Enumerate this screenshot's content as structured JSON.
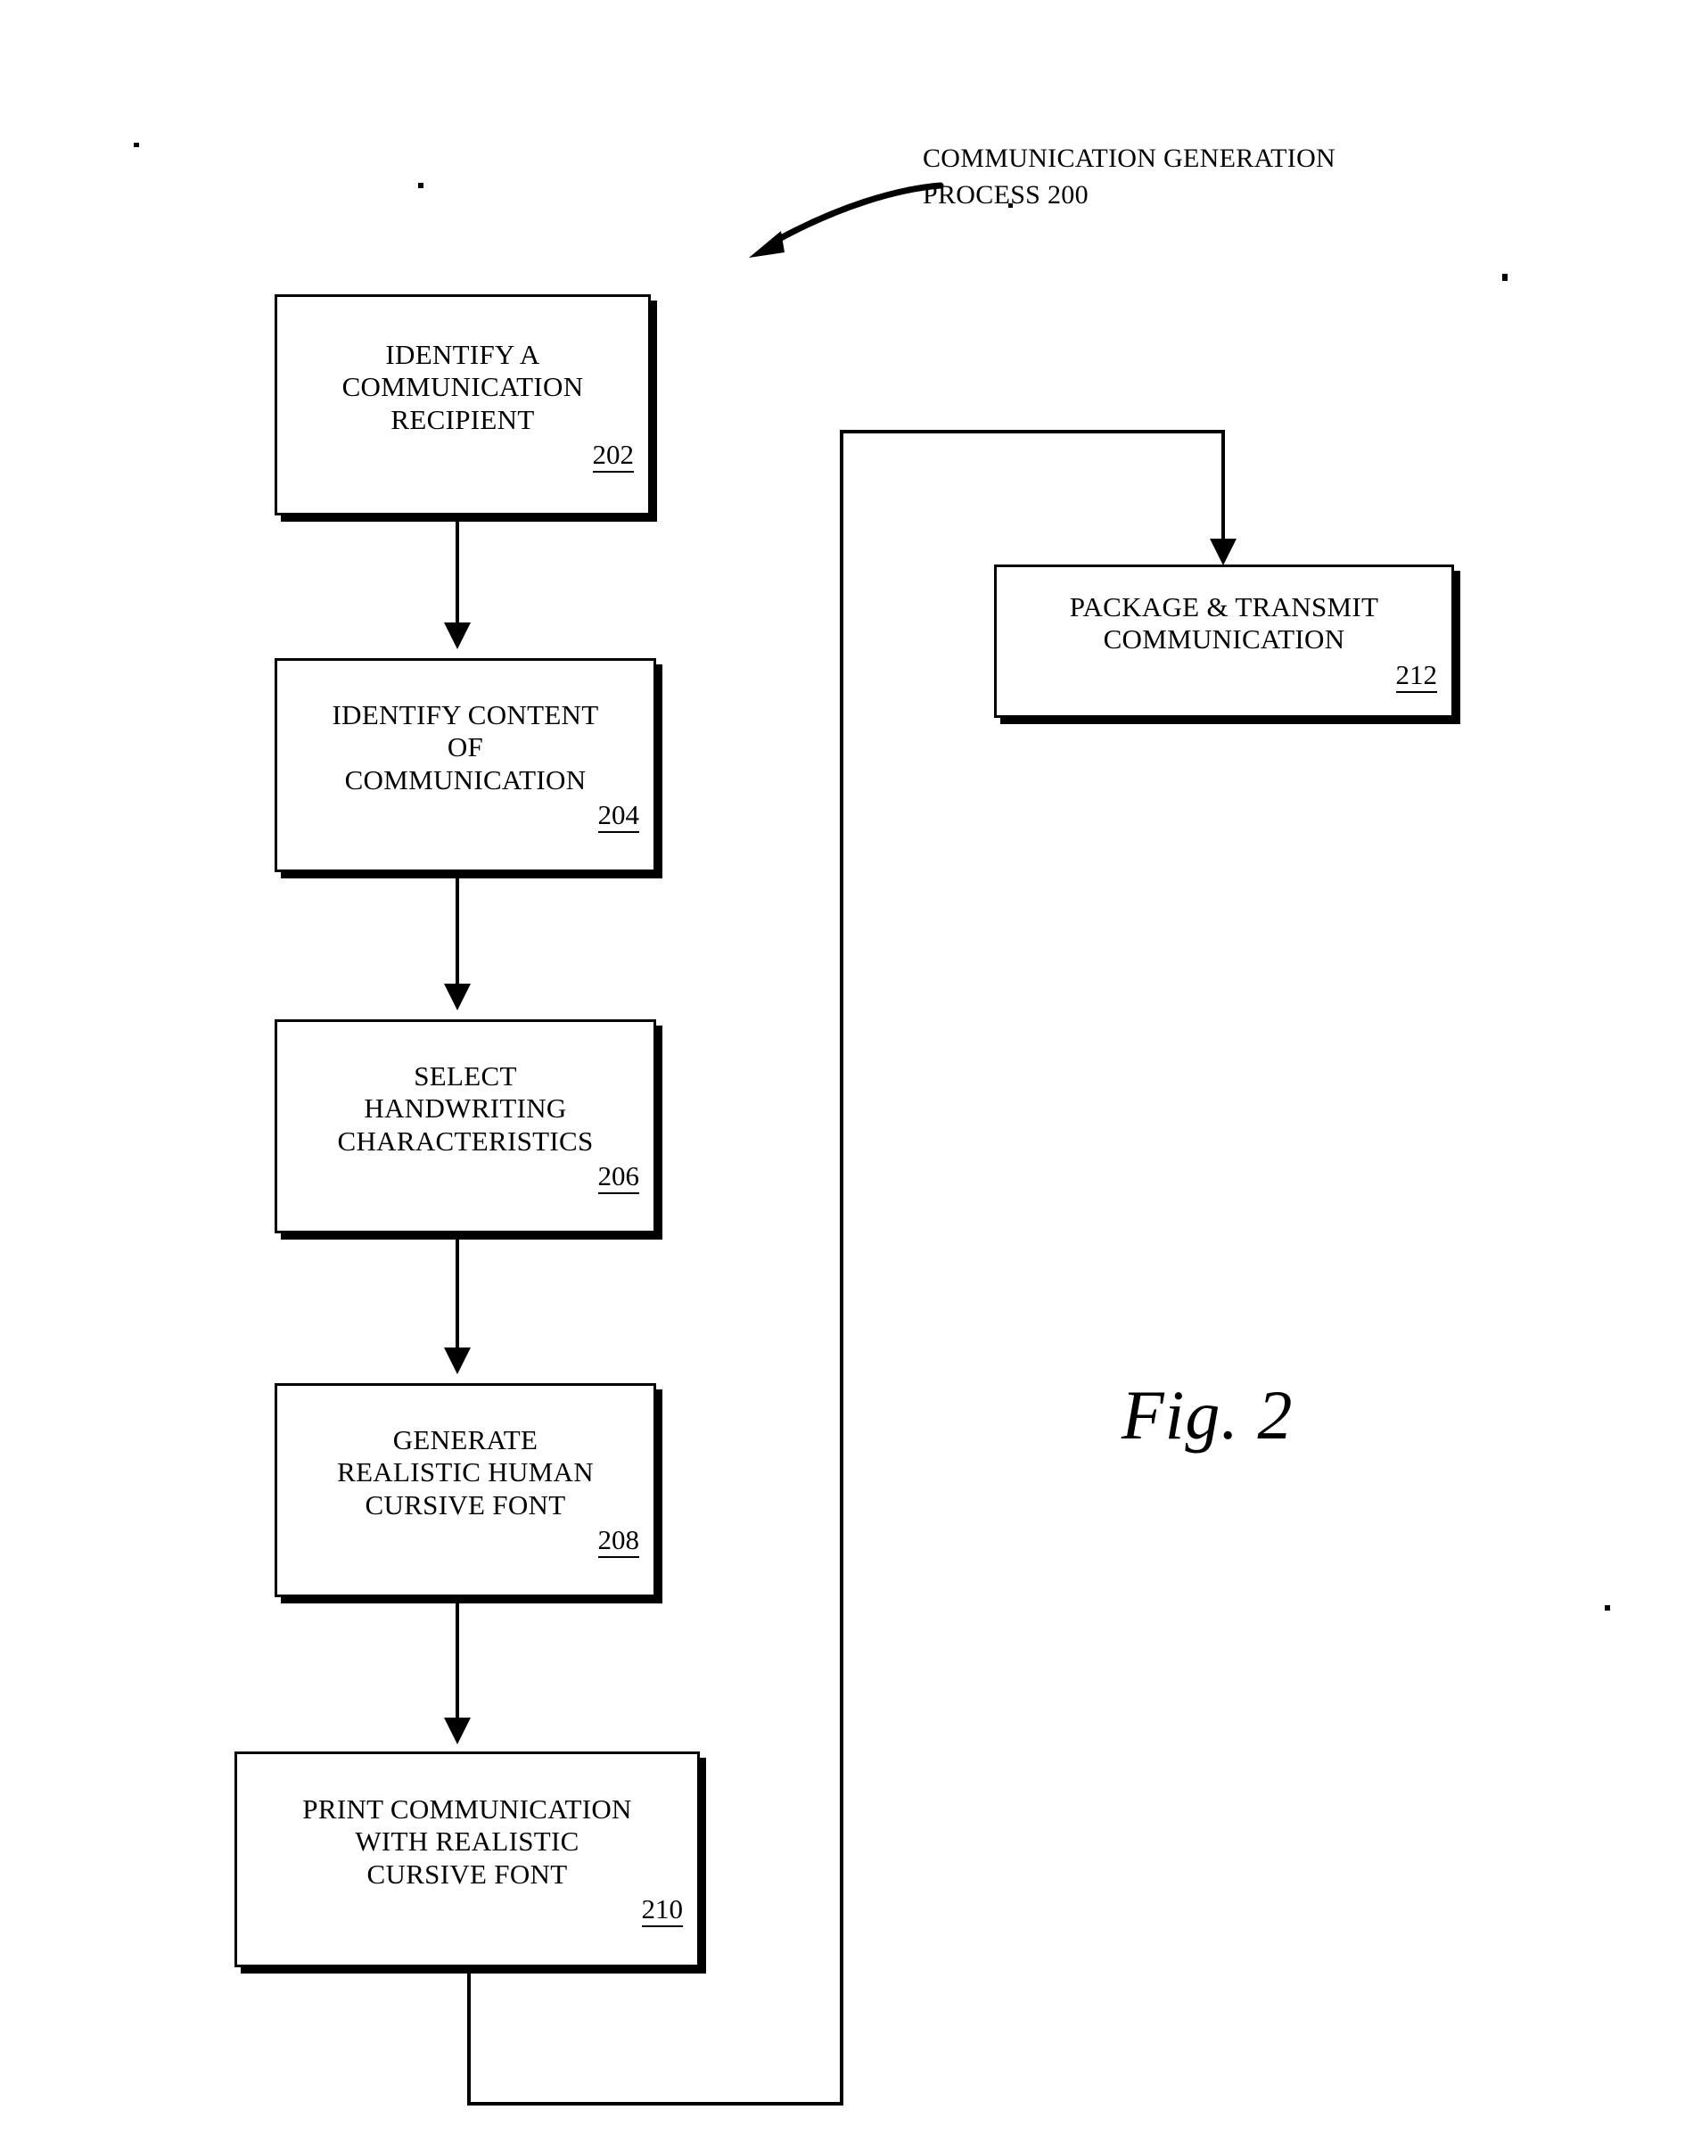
{
  "figure": {
    "label": "Fig. 2",
    "callout": "COMMUNICATION GENERATION\nPROCESS 200"
  },
  "chart_data": {
    "type": "diagram",
    "diagram_kind": "flowchart",
    "title": "COMMUNICATION GENERATION PROCESS 200",
    "figure_label": "Fig. 2",
    "nodes": [
      {
        "id": "202",
        "label": "IDENTIFY A\nCOMMUNICATION\nRECIPIENT",
        "ref": "202"
      },
      {
        "id": "204",
        "label": "IDENTIFY CONTENT\nOF\nCOMMUNICATION",
        "ref": "204"
      },
      {
        "id": "206",
        "label": "SELECT\nHANDWRITING\nCHARACTERISTICS",
        "ref": "206"
      },
      {
        "id": "208",
        "label": "GENERATE\nREALISTIC HUMAN\nCURSIVE FONT",
        "ref": "208"
      },
      {
        "id": "210",
        "label": "PRINT COMMUNICATION\nWITH REALISTIC\nCURSIVE FONT",
        "ref": "210"
      },
      {
        "id": "212",
        "label": "PACKAGE & TRANSMIT\nCOMMUNICATION",
        "ref": "212"
      }
    ],
    "edges": [
      {
        "from": "202",
        "to": "204",
        "style": "arrow-down"
      },
      {
        "from": "204",
        "to": "206",
        "style": "arrow-down"
      },
      {
        "from": "206",
        "to": "208",
        "style": "arrow-down"
      },
      {
        "from": "208",
        "to": "210",
        "style": "arrow-down"
      },
      {
        "from": "210",
        "to": "212",
        "style": "routed-arrow-down"
      }
    ]
  },
  "boxes": {
    "b202": {
      "line1": "IDENTIFY A",
      "line2": "COMMUNICATION",
      "line3": "RECIPIENT",
      "num": "202"
    },
    "b204": {
      "line1": "IDENTIFY CONTENT",
      "line2": "OF",
      "line3": "COMMUNICATION",
      "num": "204"
    },
    "b206": {
      "line1": "SELECT",
      "line2": "HANDWRITING",
      "line3": "CHARACTERISTICS",
      "num": "206"
    },
    "b208": {
      "line1": "GENERATE",
      "line2": "REALISTIC HUMAN",
      "line3": "CURSIVE FONT",
      "num": "208"
    },
    "b210": {
      "line1": "PRINT COMMUNICATION",
      "line2": "WITH REALISTIC",
      "line3": "CURSIVE FONT",
      "num": "210"
    },
    "b212": {
      "line1": "PACKAGE & TRANSMIT",
      "line2": "COMMUNICATION",
      "num": "212"
    }
  },
  "colors": {
    "ink": "#000000",
    "paper": "#ffffff"
  }
}
